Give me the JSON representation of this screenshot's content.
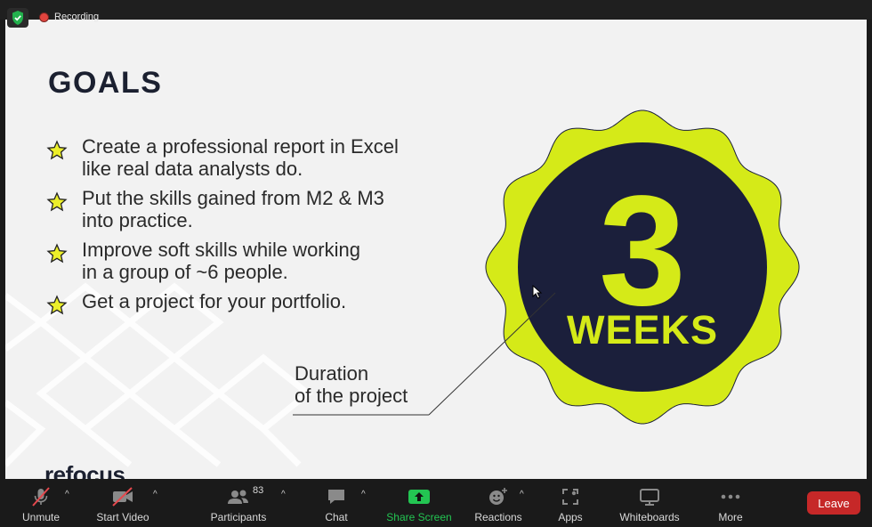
{
  "recording": {
    "label": "Recording"
  },
  "slide": {
    "title": "GOALS",
    "goals": [
      "Create a professional report in Excel\nlike real data analysts do.",
      "Put the skills gained from M2 & M3\ninto practice.",
      "Improve soft skills while working\nin a group of ~6 people.",
      "Get a project for your portfolio."
    ],
    "duration_label": "Duration\nof the project",
    "badge": {
      "number": "3",
      "unit": "WEEKS"
    },
    "logo": "refocus",
    "colors": {
      "accent": "#d5ea18",
      "navy": "#1b1f3b",
      "background": "#f2f2f2"
    }
  },
  "toolbar": {
    "unmute": "Unmute",
    "start_video": "Start Video",
    "participants": "Participants",
    "participants_count": "83",
    "chat": "Chat",
    "share_screen": "Share Screen",
    "reactions": "Reactions",
    "apps": "Apps",
    "whiteboards": "Whiteboards",
    "more": "More",
    "leave": "Leave"
  }
}
